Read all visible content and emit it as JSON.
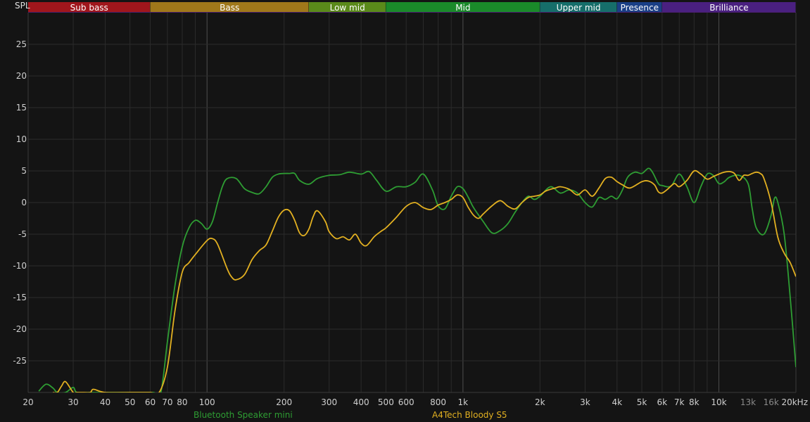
{
  "chart_data": {
    "type": "line",
    "ylabel": "SPL",
    "xscale": "log",
    "xlim": [
      20,
      20000
    ],
    "ylim": [
      -30,
      30
    ],
    "grid": true,
    "yticks": [
      25,
      20,
      15,
      10,
      5,
      0,
      -5,
      -10,
      -15,
      -20,
      -25
    ],
    "xticks": [
      {
        "value": 20,
        "label": "20"
      },
      {
        "value": 30,
        "label": "30"
      },
      {
        "value": 40,
        "label": "40"
      },
      {
        "value": 50,
        "label": "50"
      },
      {
        "value": 60,
        "label": "60"
      },
      {
        "value": 70,
        "label": "70"
      },
      {
        "value": 80,
        "label": "80"
      },
      {
        "value": 100,
        "label": "100"
      },
      {
        "value": 200,
        "label": "200"
      },
      {
        "value": 300,
        "label": "300"
      },
      {
        "value": 400,
        "label": "400"
      },
      {
        "value": 500,
        "label": "500"
      },
      {
        "value": 600,
        "label": "600"
      },
      {
        "value": 800,
        "label": "800"
      },
      {
        "value": 1000,
        "label": "1k"
      },
      {
        "value": 2000,
        "label": "2k"
      },
      {
        "value": 3000,
        "label": "3k"
      },
      {
        "value": 4000,
        "label": "4k"
      },
      {
        "value": 5000,
        "label": "5k"
      },
      {
        "value": 6000,
        "label": "6k"
      },
      {
        "value": 7000,
        "label": "7k"
      },
      {
        "value": 8000,
        "label": "8k"
      },
      {
        "value": 10000,
        "label": "10k"
      },
      {
        "value": 13000,
        "label": "13k",
        "dim": true
      },
      {
        "value": 16000,
        "label": "16k",
        "dim": true
      },
      {
        "value": 20000,
        "label": "20kHz"
      }
    ],
    "bands": [
      {
        "label": "Sub bass",
        "from": 20,
        "to": 60,
        "color": "#a0161c"
      },
      {
        "label": "Bass",
        "from": 60,
        "to": 250,
        "color": "#a0781a"
      },
      {
        "label": "Low mid",
        "from": 250,
        "to": 500,
        "color": "#5a8a1a"
      },
      {
        "label": "Mid",
        "from": 500,
        "to": 2000,
        "color": "#1a8a2a"
      },
      {
        "label": "Upper mid",
        "from": 2000,
        "to": 4000,
        "color": "#166e6a"
      },
      {
        "label": "Presence",
        "from": 4000,
        "to": 6000,
        "color": "#1a3f86"
      },
      {
        "label": "Brilliance",
        "from": 6000,
        "to": 20000,
        "color": "#4a2080"
      }
    ],
    "series": [
      {
        "name": "Bluetooth Speaker mini",
        "color": "#2e9d33",
        "x": [
          22,
          23.5,
          25,
          26,
          28,
          30,
          31,
          35,
          40,
          50,
          58,
          62,
          66,
          70,
          75,
          80,
          85,
          90,
          95,
          100,
          105,
          110,
          115,
          120,
          130,
          140,
          150,
          160,
          170,
          180,
          190,
          200,
          210,
          220,
          230,
          250,
          270,
          300,
          330,
          360,
          400,
          430,
          460,
          500,
          550,
          600,
          650,
          700,
          760,
          800,
          850,
          900,
          950,
          1000,
          1050,
          1100,
          1200,
          1300,
          1400,
          1500,
          1600,
          1700,
          1800,
          1900,
          2000,
          2200,
          2400,
          2600,
          2800,
          3000,
          3200,
          3400,
          3600,
          3800,
          4000,
          4200,
          4400,
          4700,
          5000,
          5300,
          5500,
          5800,
          6000,
          6500,
          7000,
          7500,
          8000,
          8500,
          9000,
          9500,
          10000,
          10500,
          11000,
          12000,
          13000,
          13500,
          14000,
          15000,
          16000,
          16500,
          17000,
          18000,
          19000,
          20000
        ],
        "y": [
          -29.8,
          -28.7,
          -29.3,
          -30,
          -30,
          -29.2,
          -30,
          -30,
          -30,
          -30,
          -30,
          -30,
          -30,
          -22,
          -13,
          -7,
          -4,
          -2.8,
          -3.3,
          -4.2,
          -3,
          0,
          2.6,
          3.8,
          3.8,
          2.2,
          1.6,
          1.4,
          2.5,
          4,
          4.5,
          4.6,
          4.6,
          4.6,
          3.5,
          2.9,
          3.8,
          4.3,
          4.4,
          4.8,
          4.5,
          4.9,
          3.5,
          1.8,
          2.5,
          2.5,
          3.2,
          4.5,
          2,
          -0.5,
          -1,
          1,
          2.5,
          2.2,
          0.8,
          -0.8,
          -3,
          -4.8,
          -4.4,
          -3.3,
          -1.5,
          0,
          1,
          0.5,
          1,
          2.5,
          1.5,
          2,
          1.5,
          0,
          -0.7,
          0.8,
          0.5,
          1,
          0.6,
          2,
          4,
          4.8,
          4.6,
          5.4,
          4.8,
          3,
          2.7,
          2.6,
          4.5,
          2.5,
          0,
          2.5,
          4.5,
          4.3,
          3,
          3.3,
          4,
          4.3,
          3,
          -1,
          -4,
          -5,
          -2,
          0.7,
          0,
          -5,
          -15,
          -26
        ]
      },
      {
        "name": "A4Tech Bloody S5",
        "color": "#e2b021",
        "x": [
          25,
          26,
          27,
          28,
          30,
          31,
          33,
          35,
          36,
          40,
          50,
          60,
          65,
          70,
          75,
          80,
          85,
          90,
          100,
          105,
          110,
          120,
          125,
          130,
          140,
          150,
          160,
          170,
          180,
          190,
          200,
          210,
          220,
          230,
          240,
          250,
          260,
          270,
          290,
          300,
          320,
          340,
          360,
          380,
          400,
          420,
          450,
          480,
          500,
          550,
          600,
          650,
          700,
          750,
          800,
          850,
          900,
          950,
          1000,
          1050,
          1100,
          1150,
          1200,
          1300,
          1400,
          1500,
          1600,
          1700,
          1800,
          1900,
          2000,
          2100,
          2200,
          2300,
          2400,
          2600,
          2800,
          3000,
          3200,
          3400,
          3600,
          3800,
          4000,
          4200,
          4500,
          5000,
          5300,
          5600,
          5800,
          6000,
          6300,
          6700,
          7000,
          7500,
          8000,
          8500,
          9000,
          9500,
          10000,
          10500,
          11000,
          11500,
          12000,
          12500,
          13000,
          13500,
          14000,
          14500,
          15000,
          16000,
          17000,
          18000,
          19000,
          20000
        ],
        "y": [
          -30,
          -30,
          -29,
          -28.3,
          -30,
          -30,
          -30,
          -30,
          -29.5,
          -30,
          -30,
          -30,
          -30,
          -26,
          -17,
          -11,
          -9.5,
          -8.2,
          -6,
          -5.7,
          -6.6,
          -10.5,
          -11.8,
          -12.2,
          -11.4,
          -9,
          -7.6,
          -6.7,
          -4.5,
          -2.3,
          -1.2,
          -1.3,
          -2.8,
          -4.8,
          -5.2,
          -4.2,
          -2.2,
          -1.3,
          -3,
          -4.6,
          -5.7,
          -5.4,
          -5.9,
          -5,
          -6.4,
          -6.8,
          -5.4,
          -4.5,
          -4,
          -2.3,
          -0.6,
          0,
          -0.8,
          -1.1,
          -0.4,
          0,
          0.5,
          1.2,
          0.8,
          -0.8,
          -2,
          -2.5,
          -1.8,
          -0.5,
          0.3,
          -0.6,
          -1,
          0,
          0.8,
          1,
          1.2,
          1.8,
          2.1,
          2.3,
          2.5,
          2.1,
          1.2,
          2,
          1,
          2.3,
          3.8,
          4,
          3.3,
          2.8,
          2.3,
          3.3,
          3.4,
          2.8,
          1.7,
          1.5,
          2.1,
          3,
          2.5,
          3.5,
          5,
          4.5,
          3.7,
          4.1,
          4.5,
          4.8,
          4.9,
          4.6,
          3.5,
          4.3,
          4.3,
          4.6,
          4.8,
          4.6,
          3.8,
          0,
          -5.5,
          -8,
          -9.5,
          -11.7
        ]
      }
    ]
  }
}
